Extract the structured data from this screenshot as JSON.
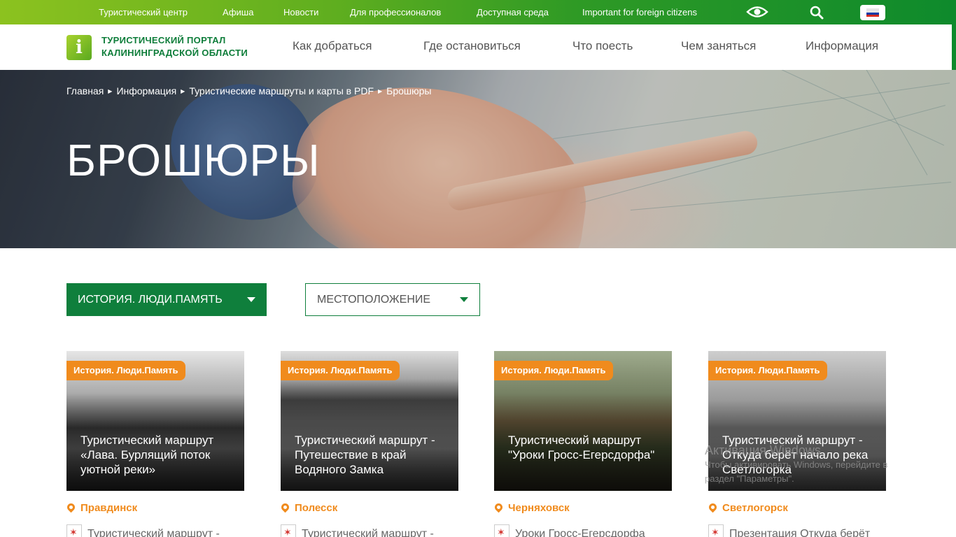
{
  "topbar": {
    "links": [
      "Туристический центр",
      "Афиша",
      "Новости",
      "Для профессионалов",
      "Доступная среда",
      "Important for foreign citizens"
    ],
    "icons": [
      "eye-icon",
      "search-icon",
      "flag-ru-icon"
    ],
    "flag_colors": [
      "#ffffff",
      "#0039a6",
      "#d52b1e"
    ]
  },
  "header": {
    "logo_letter": "i",
    "logo_line1": "ТУРИСТИЧЕСКИЙ ПОРТАЛ",
    "logo_line2": "КАЛИНИНГРАДСКОЙ ОБЛАСТИ",
    "nav": [
      "Как добраться",
      "Где остановиться",
      "Что поесть",
      "Чем заняться",
      "Информация"
    ]
  },
  "hero": {
    "breadcrumb": [
      "Главная",
      "Информация",
      "Туристические маршруты и карты в PDF",
      "Брошюры"
    ],
    "title": "БРОШЮРЫ"
  },
  "filters": {
    "category": "ИСТОРИЯ. ЛЮДИ.ПАМЯТЬ",
    "location": "МЕСТОПОЛОЖЕНИЕ"
  },
  "cards": [
    {
      "tag": "История. Люди.Память",
      "title": "Туристический маршрут «Лава. Бурлящий поток уютной реки»",
      "location": "Правдинск",
      "pdf": "Туристический маршрут -"
    },
    {
      "tag": "История. Люди.Память",
      "title": "Туристический маршрут - Путешествие в край Водяного Замка",
      "location": "Полесск",
      "pdf": "Туристический маршрут -"
    },
    {
      "tag": "История. Люди.Память",
      "title": "Туристический маршрут \"Уроки Гросс-Егерсдорфа\"",
      "location": "Черняховск",
      "pdf": "Уроки Гросс-Егерсдорфа"
    },
    {
      "tag": "История. Люди.Память",
      "title": "Туристический маршрут - Откуда берёт начало река Светлогорка",
      "location": "Светлогорск",
      "pdf": "Презентация Откуда берёт"
    }
  ],
  "watermark": {
    "line1": "Активация Windows",
    "line2": "Чтобы активировать Windows, перейдите в",
    "line3": "раздел \"Параметры\"."
  },
  "colors": {
    "brand_green": "#0f7f3c",
    "accent_orange": "#f08b1d"
  }
}
